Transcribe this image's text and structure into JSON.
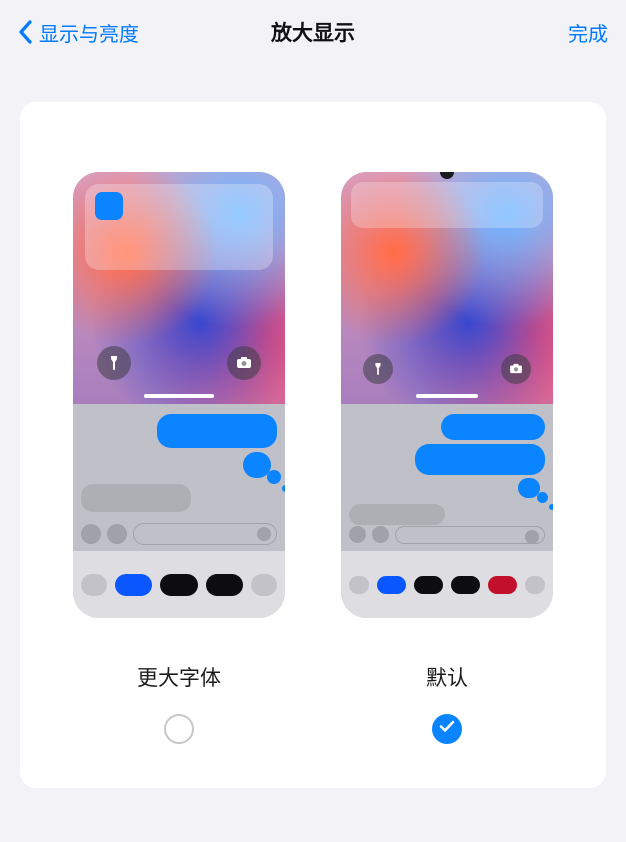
{
  "nav": {
    "back_label": "显示与亮度",
    "title": "放大显示",
    "done_label": "完成"
  },
  "options": {
    "larger": {
      "label": "更大字体",
      "selected": false
    },
    "default": {
      "label": "默认",
      "selected": true
    }
  },
  "colors": {
    "accent": "#0a84ff",
    "link": "#007aff"
  },
  "icons": {
    "back_chevron": "chevron-left-icon",
    "flashlight": "flashlight-icon",
    "camera": "camera-icon",
    "check": "check-icon"
  }
}
